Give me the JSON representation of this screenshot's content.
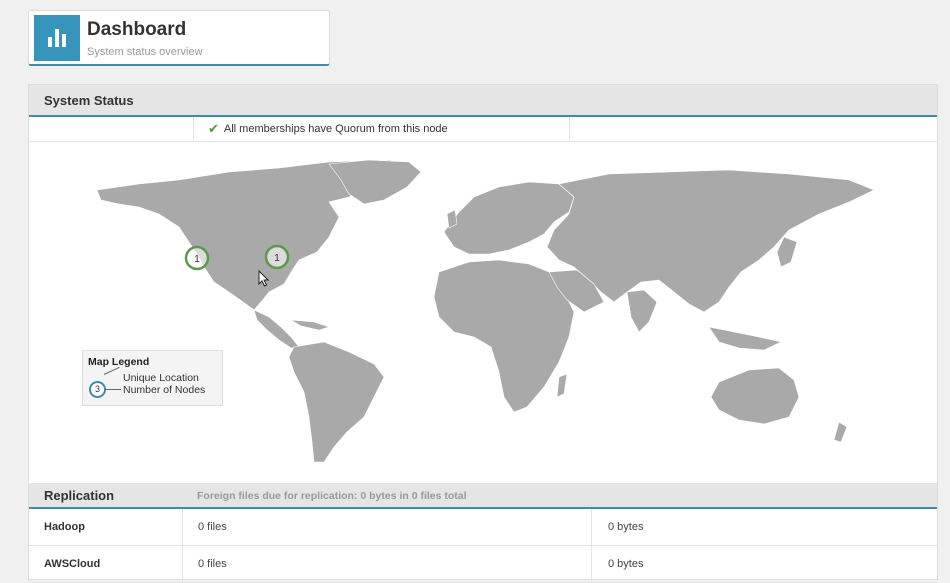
{
  "header": {
    "title": "Dashboard",
    "subtitle": "System status overview",
    "icon": "bar-chart-icon",
    "accent": "#3794ba"
  },
  "system_status": {
    "title": "System Status",
    "quorum_message": "All memberships have Quorum from this node",
    "quorum_icon": "check-icon",
    "status_color": "#4a9c3c"
  },
  "map": {
    "markers": [
      {
        "label": "1",
        "location": "US West Coast"
      },
      {
        "label": "1",
        "location": "US East Coast"
      }
    ],
    "marker_color": "#5a9a4a",
    "land_color": "#a9a9a9"
  },
  "legend": {
    "title": "Map Legend",
    "sample_value": "3",
    "unique_location": "Unique Location",
    "number_of_nodes": "Number of Nodes"
  },
  "replication": {
    "title": "Replication",
    "info": "Foreign files due for replication: 0 bytes in 0 files total",
    "rows": [
      {
        "name": "Hadoop",
        "files": "0 files",
        "bytes": "0 bytes"
      },
      {
        "name": "AWSCloud",
        "files": "0 files",
        "bytes": "0 bytes"
      }
    ]
  }
}
